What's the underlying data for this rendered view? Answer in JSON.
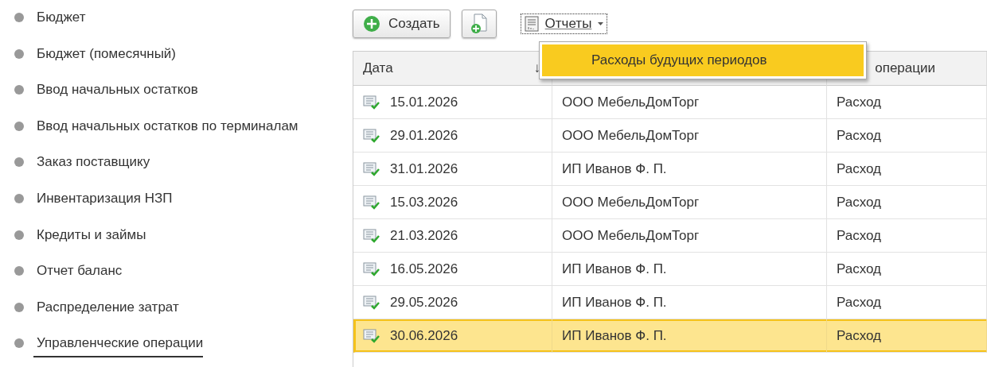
{
  "sidebar": {
    "items": [
      {
        "label": "Бюджет",
        "selected": false
      },
      {
        "label": "Бюджет (помесячный)",
        "selected": false
      },
      {
        "label": "Ввод начальных остатков",
        "selected": false
      },
      {
        "label": "Ввод начальных остатков по терминалам",
        "selected": false
      },
      {
        "label": "Заказ поставщику",
        "selected": false
      },
      {
        "label": "Инвентаризация НЗП",
        "selected": false
      },
      {
        "label": "Кредиты и займы",
        "selected": false
      },
      {
        "label": "Отчет баланс",
        "selected": false
      },
      {
        "label": "Распределение затрат",
        "selected": false
      },
      {
        "label": "Управленческие операции",
        "selected": true
      }
    ]
  },
  "toolbar": {
    "create_button": "Создать",
    "reports_menu": {
      "label": "Отчеты",
      "expanded": true,
      "items": [
        {
          "label": "Расходы будущих периодов",
          "selected": true
        }
      ]
    }
  },
  "table": {
    "columns": [
      {
        "label": "Дата",
        "sort": "↓"
      },
      {
        "label": "операции"
      }
    ],
    "rows": [
      {
        "date": "15.01.2026",
        "counterparty": "ООО МебельДомТорг",
        "operation": "Расход",
        "selected": false
      },
      {
        "date": "29.01.2026",
        "counterparty": "ООО МебельДомТорг",
        "operation": "Расход",
        "selected": false
      },
      {
        "date": "31.01.2026",
        "counterparty": "ИП Иванов Ф. П.",
        "operation": "Расход",
        "selected": false
      },
      {
        "date": "15.03.2026",
        "counterparty": "ООО МебельДомТорг",
        "operation": "Расход",
        "selected": false
      },
      {
        "date": "21.03.2026",
        "counterparty": "ООО МебельДомТорг",
        "operation": "Расход",
        "selected": false
      },
      {
        "date": "16.05.2026",
        "counterparty": "ИП Иванов Ф. П.",
        "operation": "Расход",
        "selected": false
      },
      {
        "date": "29.05.2026",
        "counterparty": "ИП Иванов Ф. П.",
        "operation": "Расход",
        "selected": false
      },
      {
        "date": "30.06.2026",
        "counterparty": "ИП Иванов Ф. П.",
        "operation": "Расход",
        "selected": true
      }
    ]
  }
}
